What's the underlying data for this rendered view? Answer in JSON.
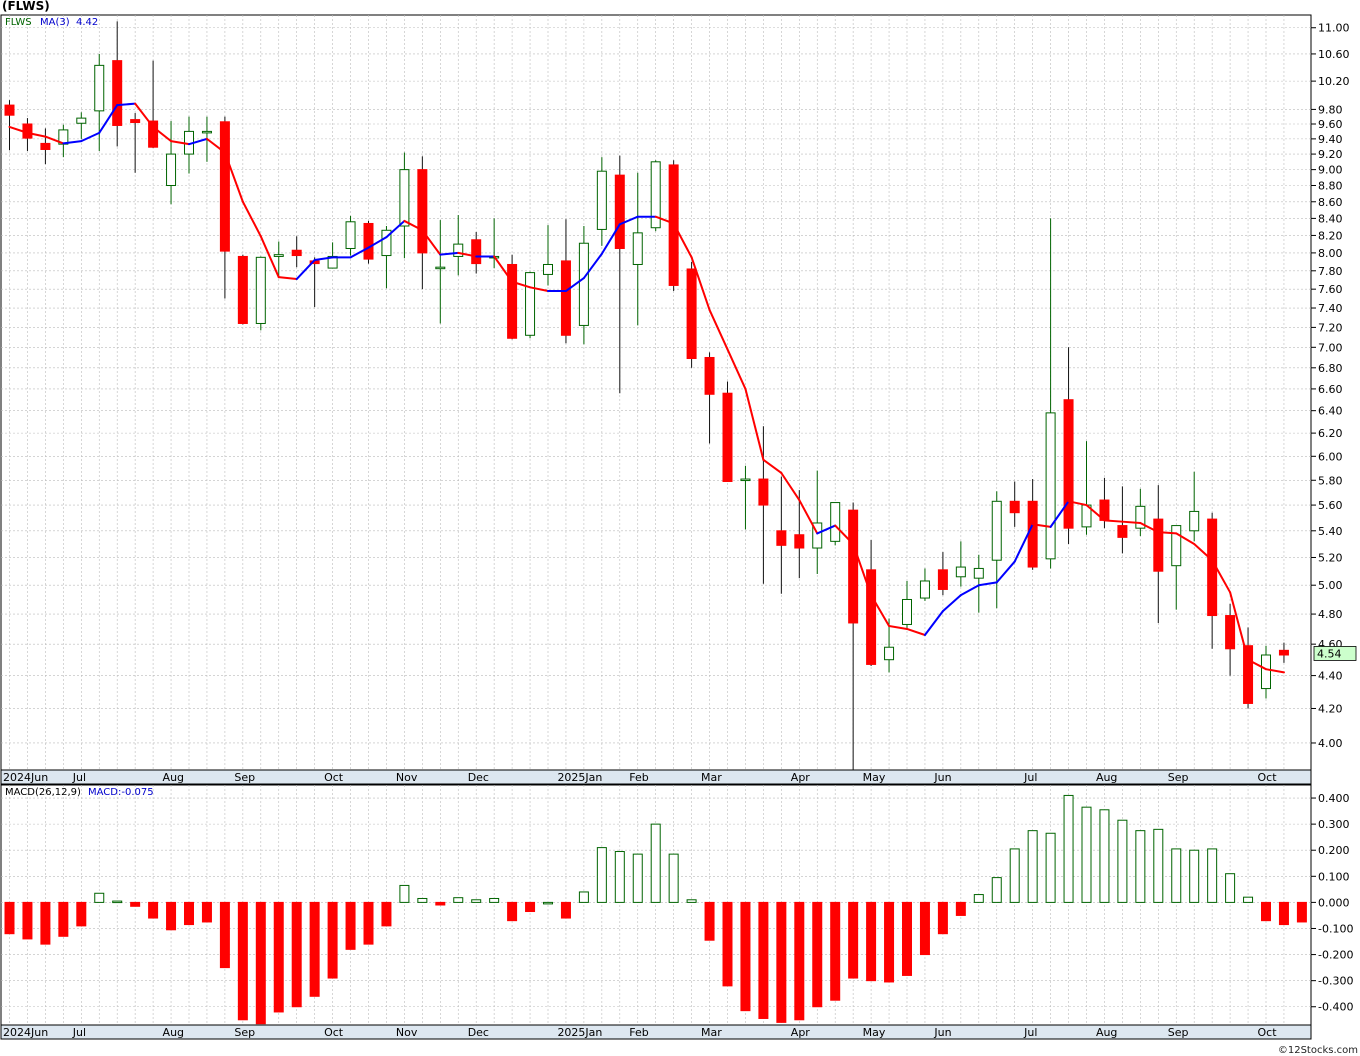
{
  "title": "(FLWS)",
  "footer": "©12Stocks.com",
  "colors": {
    "up": "#006400",
    "down": "#ff0000",
    "ma_up": "#0000ff",
    "ma_down": "#ff0000",
    "last_bg": "#ccffcc",
    "grid": "#bbbbbb"
  },
  "price_panel": {
    "legend": {
      "symbol": "FLWS",
      "ma_label": "MA(3)",
      "ma_value": "4.42"
    },
    "last_price_label": "4.54",
    "y_ticks": [
      "11.00",
      "10.60",
      "10.20",
      "9.80",
      "9.60",
      "9.40",
      "9.20",
      "9.00",
      "8.80",
      "8.60",
      "8.40",
      "8.20",
      "8.00",
      "7.80",
      "7.60",
      "7.40",
      "7.20",
      "7.00",
      "6.80",
      "6.60",
      "6.40",
      "6.20",
      "6.00",
      "5.80",
      "5.60",
      "5.40",
      "5.20",
      "5.00",
      "4.80",
      "4.60",
      "4.40",
      "4.20",
      "4.00"
    ]
  },
  "macd_panel": {
    "legend": {
      "label": "MACD(26,12,9)",
      "value_label": "MACD:-0.075"
    },
    "y_ticks": [
      "0.400",
      "0.300",
      "0.200",
      "0.100",
      "0.000",
      "-0.100",
      "-0.200",
      "-0.300",
      "-0.400"
    ]
  },
  "x_labels": [
    "2024Jun",
    "Jul",
    "Aug",
    "Sep",
    "Oct",
    "Nov",
    "Dec",
    "2025Jan",
    "Feb",
    "Mar",
    "Apr",
    "May",
    "Jun",
    "Jul",
    "Aug",
    "Sep",
    "Oct"
  ],
  "chart_data": [
    {
      "type": "candlestick",
      "scale": "log",
      "ylim": [
        3.85,
        11.2
      ],
      "x_labels": [
        "2024Jun",
        "Jul",
        "Aug",
        "Sep",
        "Oct",
        "Nov",
        "Dec",
        "2025Jan",
        "Feb",
        "Mar",
        "Apr",
        "May",
        "Jun",
        "Jul",
        "Aug",
        "Sep",
        "Oct"
      ],
      "x_label_index": [
        0,
        4,
        9,
        13,
        18,
        22,
        26,
        31,
        35,
        39,
        44,
        48,
        52,
        57,
        61,
        65,
        70
      ],
      "ohlc": [
        [
          9.86,
          9.93,
          9.25,
          9.72
        ],
        [
          9.6,
          9.68,
          9.24,
          9.41
        ],
        [
          9.34,
          9.54,
          9.07,
          9.26
        ],
        [
          9.33,
          9.59,
          9.16,
          9.52
        ],
        [
          9.61,
          9.76,
          9.4,
          9.68
        ],
        [
          9.78,
          10.6,
          9.24,
          10.43
        ],
        [
          10.5,
          11.1,
          9.3,
          9.58
        ],
        [
          9.66,
          9.75,
          8.96,
          9.62
        ],
        [
          9.64,
          10.5,
          9.28,
          9.29
        ],
        [
          8.8,
          9.64,
          8.57,
          9.2
        ],
        [
          9.2,
          9.7,
          8.95,
          9.5
        ],
        [
          9.48,
          9.7,
          9.1,
          9.5
        ],
        [
          9.63,
          9.7,
          7.5,
          8.02
        ],
        [
          7.96,
          7.98,
          7.23,
          7.24
        ],
        [
          7.24,
          7.96,
          7.17,
          7.95
        ],
        [
          7.96,
          8.13,
          7.73,
          7.98
        ],
        [
          8.03,
          8.19,
          7.84,
          7.97
        ],
        [
          7.91,
          7.95,
          7.41,
          7.88
        ],
        [
          7.83,
          8.12,
          7.83,
          7.96
        ],
        [
          8.05,
          8.43,
          7.97,
          8.36
        ],
        [
          8.34,
          8.37,
          7.88,
          7.93
        ],
        [
          7.97,
          8.31,
          7.61,
          8.26
        ],
        [
          8.31,
          9.22,
          7.94,
          9.0
        ],
        [
          9.0,
          9.17,
          7.6,
          8.0
        ],
        [
          7.84,
          8.38,
          7.24,
          7.84
        ],
        [
          7.96,
          8.44,
          7.75,
          8.1
        ],
        [
          8.15,
          8.24,
          7.77,
          7.88
        ],
        [
          7.96,
          8.4,
          7.83,
          7.96
        ],
        [
          7.87,
          7.98,
          7.08,
          7.09
        ],
        [
          7.12,
          7.79,
          7.09,
          7.78
        ],
        [
          7.76,
          8.32,
          7.64,
          7.87
        ],
        [
          7.91,
          8.39,
          7.04,
          7.12
        ],
        [
          7.22,
          8.31,
          7.03,
          8.11
        ],
        [
          8.27,
          9.16,
          8.08,
          8.98
        ],
        [
          8.93,
          9.18,
          6.56,
          8.05
        ],
        [
          7.87,
          8.96,
          7.22,
          8.23
        ],
        [
          8.29,
          9.12,
          8.25,
          9.1
        ],
        [
          9.06,
          9.12,
          7.58,
          7.64
        ],
        [
          7.82,
          7.9,
          6.8,
          6.89
        ],
        [
          6.9,
          6.95,
          6.11,
          6.55
        ],
        [
          6.56,
          6.67,
          5.79,
          5.79
        ],
        [
          5.8,
          5.92,
          5.41,
          5.81
        ],
        [
          5.81,
          6.26,
          5.01,
          5.6
        ],
        [
          5.4,
          5.83,
          4.94,
          5.29
        ],
        [
          5.37,
          5.72,
          5.05,
          5.27
        ],
        [
          5.27,
          5.88,
          5.08,
          5.46
        ],
        [
          5.32,
          5.61,
          5.29,
          5.62
        ],
        [
          5.56,
          5.62,
          3.85,
          4.74
        ],
        [
          5.11,
          5.33,
          4.46,
          4.47
        ],
        [
          4.5,
          4.77,
          4.42,
          4.58
        ],
        [
          4.73,
          5.03,
          4.7,
          4.9
        ],
        [
          4.91,
          5.12,
          4.89,
          5.03
        ],
        [
          5.11,
          5.24,
          4.93,
          4.97
        ],
        [
          5.06,
          5.32,
          4.99,
          5.13
        ],
        [
          5.05,
          5.22,
          4.81,
          5.12
        ],
        [
          5.18,
          5.71,
          4.84,
          5.63
        ],
        [
          5.63,
          5.79,
          5.43,
          5.54
        ],
        [
          5.63,
          5.81,
          5.11,
          5.13
        ],
        [
          5.19,
          8.4,
          5.12,
          6.38
        ],
        [
          6.5,
          7.0,
          5.3,
          5.42
        ],
        [
          5.43,
          6.13,
          5.37,
          5.6
        ],
        [
          5.64,
          5.82,
          5.42,
          5.48
        ],
        [
          5.44,
          5.75,
          5.23,
          5.35
        ],
        [
          5.42,
          5.73,
          5.36,
          5.59
        ],
        [
          5.49,
          5.76,
          4.74,
          5.1
        ],
        [
          5.14,
          5.43,
          4.83,
          5.44
        ],
        [
          5.4,
          5.87,
          5.32,
          5.55
        ],
        [
          5.49,
          5.54,
          4.57,
          4.79
        ],
        [
          4.79,
          4.87,
          4.4,
          4.57
        ],
        [
          4.59,
          4.71,
          4.2,
          4.23
        ],
        [
          4.32,
          4.59,
          4.26,
          4.53
        ],
        [
          4.56,
          4.61,
          4.48,
          4.53
        ]
      ],
      "ma": {
        "name": "MA(3)",
        "values": [
          9.56,
          9.48,
          9.43,
          9.34,
          9.37,
          9.48,
          9.86,
          9.88,
          9.56,
          9.37,
          9.33,
          9.4,
          9.22,
          8.6,
          8.19,
          7.73,
          7.71,
          7.92,
          7.95,
          7.95,
          8.06,
          8.18,
          8.37,
          8.26,
          7.98,
          8.0,
          7.96,
          7.96,
          7.68,
          7.62,
          7.58,
          7.58,
          7.72,
          7.99,
          8.33,
          8.42,
          8.42,
          8.34,
          7.95,
          7.38,
          6.98,
          6.6,
          5.97,
          5.86,
          5.64,
          5.38,
          5.44,
          5.3,
          4.93,
          4.72,
          4.7,
          4.66,
          4.82,
          4.93,
          5.0,
          5.02,
          5.17,
          5.45,
          5.43,
          5.63,
          5.6,
          5.48,
          5.47,
          5.46,
          5.39,
          5.38,
          5.3,
          5.18,
          4.95,
          4.5,
          4.44,
          4.42
        ]
      },
      "last_price": 4.54
    },
    {
      "type": "bar",
      "name": "MACD(26,12,9)",
      "ylim": [
        -0.47,
        0.45
      ],
      "values": [
        -0.12,
        -0.14,
        -0.16,
        -0.13,
        -0.09,
        0.035,
        0.005,
        -0.015,
        -0.06,
        -0.105,
        -0.085,
        -0.075,
        -0.25,
        -0.45,
        -0.465,
        -0.42,
        -0.4,
        -0.36,
        -0.29,
        -0.18,
        -0.16,
        -0.09,
        0.065,
        0.015,
        -0.01,
        0.018,
        0.01,
        0.015,
        -0.07,
        -0.035,
        0.0,
        -0.06,
        0.04,
        0.21,
        0.195,
        0.185,
        0.3,
        0.185,
        0.01,
        -0.145,
        -0.32,
        -0.415,
        -0.445,
        -0.46,
        -0.45,
        -0.4,
        -0.375,
        -0.29,
        -0.3,
        -0.305,
        -0.28,
        -0.2,
        -0.12,
        -0.05,
        0.03,
        0.095,
        0.205,
        0.275,
        0.265,
        0.41,
        0.365,
        0.355,
        0.315,
        0.275,
        0.28,
        0.205,
        0.2,
        0.205,
        0.11,
        0.02,
        -0.07,
        -0.085,
        -0.075
      ],
      "value_label": "MACD:-0.075"
    }
  ]
}
